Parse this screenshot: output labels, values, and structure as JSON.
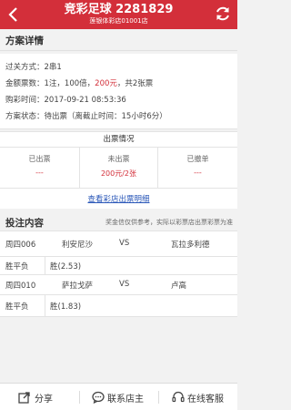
{
  "header": {
    "title": "竞彩足球  2281829",
    "subtitle": "莲银体彩店01001店"
  },
  "details_section": {
    "heading": "方案详情",
    "pass_label": "过关方式：",
    "pass_value": "2串1",
    "amount_label": "金额票数：",
    "amount_prefix": "1注，100倍，",
    "amount_red": "200元",
    "amount_suffix": "，共2张票",
    "time_label": "购彩时间：",
    "time_value": "2017-09-21 08:53:36",
    "status_label": "方案状态：",
    "status_value": "待出票（离截止时间：15小时6分）"
  },
  "ticket_status": {
    "heading": "出票情况",
    "columns": [
      {
        "label": "已出票",
        "value": "---"
      },
      {
        "label": "未出票",
        "value": "200元/2张"
      },
      {
        "label": "已撤单",
        "value": "---"
      }
    ],
    "link_text": "查看彩店出票明细"
  },
  "bet_section": {
    "heading": "投注内容",
    "note": "奖金信仅供参考，实际以彩票店出票彩票为准",
    "matches": [
      {
        "id": "周四006",
        "home": "利安尼沙",
        "vs": "VS",
        "away": "瓦拉多利德",
        "play": "胜平负",
        "pick": "胜(2.53)"
      },
      {
        "id": "周四010",
        "home": "萨拉戈萨",
        "vs": "VS",
        "away": "卢高",
        "play": "胜平负",
        "pick": "胜(1.83)"
      }
    ]
  },
  "bottom_bar": {
    "share": "分享",
    "contact": "联系店主",
    "service": "在线客服"
  },
  "colors": {
    "brand_red": "#d32f3a",
    "link_blue": "#2a57b8"
  }
}
